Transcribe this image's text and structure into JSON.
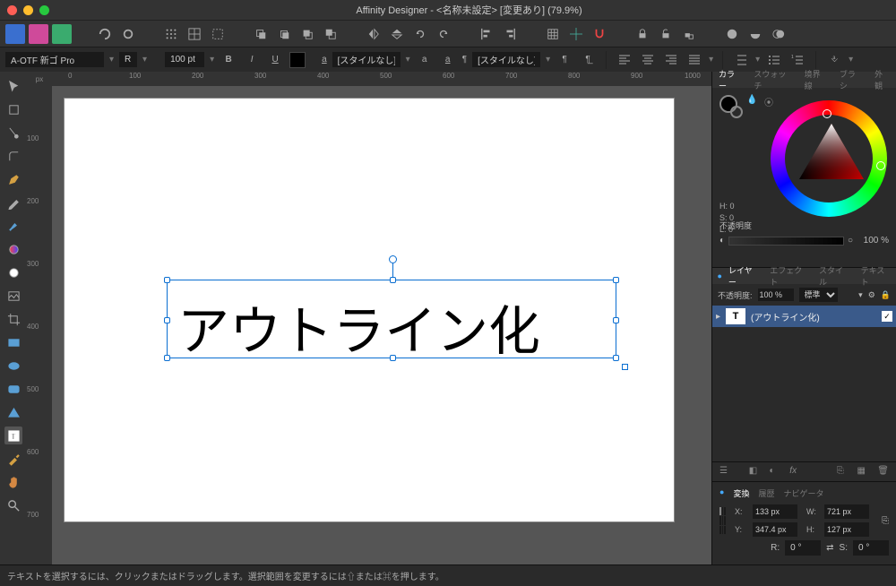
{
  "title": "Affinity Designer - <名称未設定> [変更あり] (79.9%)",
  "ctx": {
    "font": "A-OTF 新ゴ Pro",
    "weight": "R",
    "size": "100 pt",
    "style_none": "[スタイルなし]",
    "para_style": "[スタイルなし]"
  },
  "canvas_text": "アウトライン化",
  "ruler_h": [
    "0",
    "100",
    "200",
    "300",
    "400",
    "500",
    "600",
    "700",
    "800",
    "900",
    "1000"
  ],
  "ruler_v": [
    "100",
    "200",
    "300",
    "400",
    "500",
    "600",
    "700"
  ],
  "unit": "px",
  "color": {
    "tabs": [
      "カラー",
      "スウォッチ",
      "境界線",
      "ブラシ",
      "外観"
    ],
    "h": "H: 0",
    "s": "S: 0",
    "l": "L: 0",
    "opac_label": "不透明度",
    "opac_val": "100 %"
  },
  "layers": {
    "tabs": [
      "レイヤー",
      "エフェクト",
      "スタイル",
      "テキスト"
    ],
    "opac_label": "不透明度:",
    "opac_val": "100 %",
    "blend": "標準",
    "layer_name": "(アウトライン化)"
  },
  "transform": {
    "tabs": [
      "変換",
      "履歴",
      "ナビゲータ"
    ],
    "x_lbl": "X:",
    "x": "133 px",
    "y_lbl": "Y:",
    "y": "347.4 px",
    "w_lbl": "W:",
    "w": "721 px",
    "h_lbl": "H:",
    "h": "127 px",
    "r_lbl": "R:",
    "r": "0 °",
    "s_lbl": "S:",
    "s": "0 °"
  },
  "status": "テキストを選択するには、クリックまたはドラッグします。選択範囲を変更するには⇧または⌘を押します。"
}
